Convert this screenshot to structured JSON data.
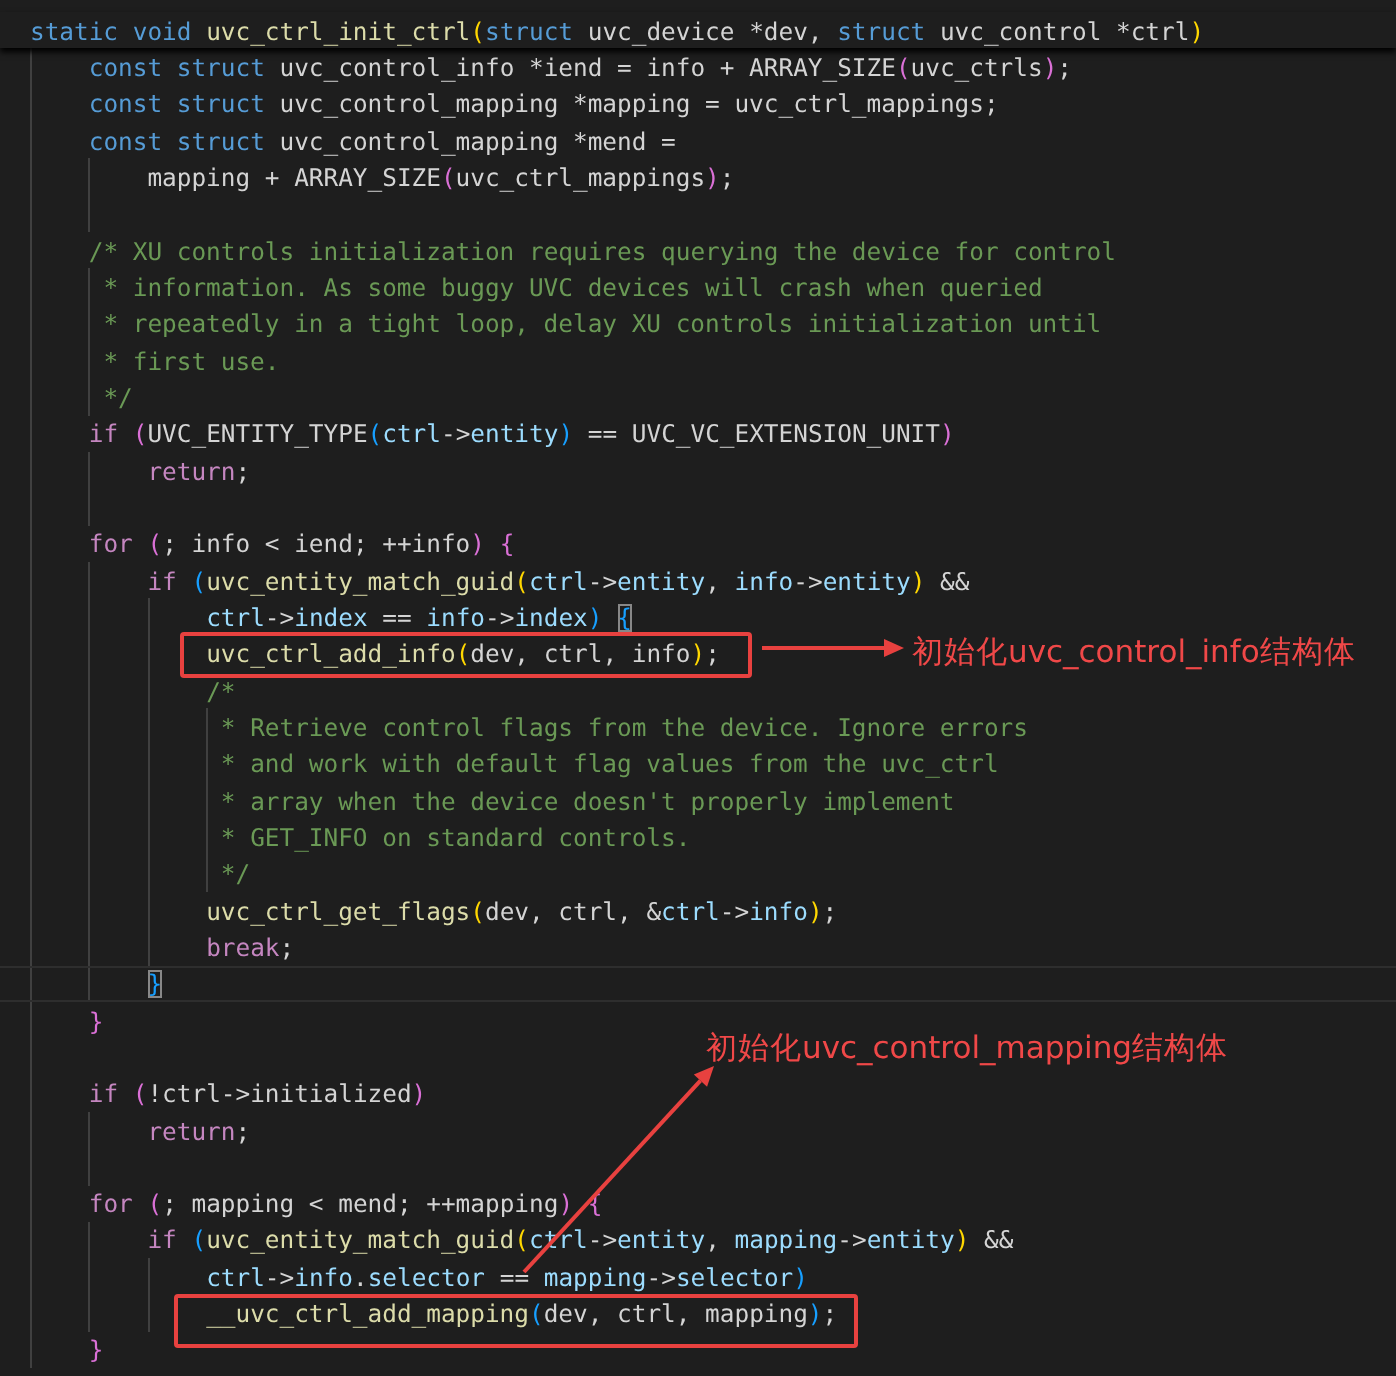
{
  "editor": {
    "lines": [
      {
        "kind": "header",
        "current": false,
        "tokens": [
          {
            "kind": "keyword",
            "text": "static void "
          },
          {
            "kind": "function",
            "text": "uvc_ctrl_init_ctrl"
          },
          {
            "kind": "bracket1",
            "text": "("
          },
          {
            "kind": "keyword",
            "text": "struct"
          },
          {
            "kind": "text",
            "text": " uvc_device *dev, "
          },
          {
            "kind": "keyword",
            "text": "struct"
          },
          {
            "kind": "text",
            "text": " uvc_control *ctrl"
          },
          {
            "kind": "bracket1",
            "text": ")"
          }
        ]
      },
      {
        "kind": "code",
        "current": false,
        "tokens": [
          {
            "kind": "keyword",
            "text": "    const struct"
          },
          {
            "kind": "text",
            "text": " uvc_control_info *iend = info + ARRAY_SIZE"
          },
          {
            "kind": "bracket2",
            "text": "("
          },
          {
            "kind": "text",
            "text": "uvc_ctrls"
          },
          {
            "kind": "bracket2",
            "text": ")"
          },
          {
            "kind": "text",
            "text": ";"
          }
        ]
      },
      {
        "kind": "code",
        "current": false,
        "tokens": [
          {
            "kind": "keyword",
            "text": "    const struct"
          },
          {
            "kind": "text",
            "text": " uvc_control_mapping *mapping = uvc_ctrl_mappings;"
          }
        ]
      },
      {
        "kind": "code",
        "current": false,
        "tokens": [
          {
            "kind": "keyword",
            "text": "    const struct"
          },
          {
            "kind": "text",
            "text": " uvc_control_mapping *mend ="
          }
        ]
      },
      {
        "kind": "code",
        "current": false,
        "tokens": [
          {
            "kind": "text",
            "text": "        mapping + ARRAY_SIZE"
          },
          {
            "kind": "bracket2",
            "text": "("
          },
          {
            "kind": "text",
            "text": "uvc_ctrl_mappings"
          },
          {
            "kind": "bracket2",
            "text": ")"
          },
          {
            "kind": "text",
            "text": ";"
          }
        ]
      },
      {
        "kind": "blank",
        "current": false
      },
      {
        "kind": "code",
        "current": false,
        "tokens": [
          {
            "kind": "comment",
            "text": "    /* XU controls initialization requires querying the device for control"
          }
        ]
      },
      {
        "kind": "code",
        "current": false,
        "tokens": [
          {
            "kind": "comment",
            "text": "     * information. As some buggy UVC devices will crash when queried"
          }
        ]
      },
      {
        "kind": "code",
        "current": false,
        "tokens": [
          {
            "kind": "comment",
            "text": "     * repeatedly in a tight loop, delay XU controls initialization until"
          }
        ]
      },
      {
        "kind": "code",
        "current": false,
        "tokens": [
          {
            "kind": "comment",
            "text": "     * first use."
          }
        ]
      },
      {
        "kind": "code",
        "current": false,
        "tokens": [
          {
            "kind": "comment",
            "text": "     */"
          }
        ]
      },
      {
        "kind": "code",
        "current": false,
        "tokens": [
          {
            "kind": "control",
            "text": "    if "
          },
          {
            "kind": "bracket2",
            "text": "("
          },
          {
            "kind": "text",
            "text": "UVC_ENTITY_TYPE"
          },
          {
            "kind": "bracket3",
            "text": "("
          },
          {
            "kind": "variable",
            "text": "ctrl"
          },
          {
            "kind": "text",
            "text": "->"
          },
          {
            "kind": "variable",
            "text": "entity"
          },
          {
            "kind": "bracket3",
            "text": ")"
          },
          {
            "kind": "text",
            "text": " == UVC_VC_EXTENSION_UNIT"
          },
          {
            "kind": "bracket2",
            "text": ")"
          }
        ]
      },
      {
        "kind": "code",
        "current": false,
        "tokens": [
          {
            "kind": "control",
            "text": "        return"
          },
          {
            "kind": "text",
            "text": ";"
          }
        ]
      },
      {
        "kind": "blank",
        "current": false
      },
      {
        "kind": "code",
        "current": false,
        "tokens": [
          {
            "kind": "control",
            "text": "    for "
          },
          {
            "kind": "bracket2",
            "text": "("
          },
          {
            "kind": "text",
            "text": "; info < iend; ++info"
          },
          {
            "kind": "bracket2",
            "text": ") {"
          }
        ]
      },
      {
        "kind": "code",
        "current": false,
        "tokens": [
          {
            "kind": "control",
            "text": "        if "
          },
          {
            "kind": "bracket3",
            "text": "("
          },
          {
            "kind": "function",
            "text": "uvc_entity_match_guid"
          },
          {
            "kind": "bracket1",
            "text": "("
          },
          {
            "kind": "variable",
            "text": "ctrl"
          },
          {
            "kind": "text",
            "text": "->"
          },
          {
            "kind": "variable",
            "text": "entity"
          },
          {
            "kind": "text",
            "text": ", "
          },
          {
            "kind": "variable",
            "text": "info"
          },
          {
            "kind": "text",
            "text": "->"
          },
          {
            "kind": "variable",
            "text": "entity"
          },
          {
            "kind": "bracket1",
            "text": ")"
          },
          {
            "kind": "text",
            "text": " &&"
          }
        ]
      },
      {
        "kind": "code",
        "current": false,
        "tokens": [
          {
            "kind": "variable",
            "text": "            ctrl"
          },
          {
            "kind": "text",
            "text": "->"
          },
          {
            "kind": "variable",
            "text": "index"
          },
          {
            "kind": "text",
            "text": " == "
          },
          {
            "kind": "variable",
            "text": "info"
          },
          {
            "kind": "text",
            "text": "->"
          },
          {
            "kind": "variable",
            "text": "index"
          },
          {
            "kind": "bracket3",
            "text": ") "
          },
          {
            "kind": "match",
            "text": "{"
          }
        ]
      },
      {
        "kind": "code",
        "current": false,
        "tokens": [
          {
            "kind": "function",
            "text": "            uvc_ctrl_add_info"
          },
          {
            "kind": "bracket1",
            "text": "("
          },
          {
            "kind": "text",
            "text": "dev, ctrl, info"
          },
          {
            "kind": "bracket1",
            "text": ")"
          },
          {
            "kind": "text",
            "text": ";"
          }
        ]
      },
      {
        "kind": "code",
        "current": false,
        "tokens": [
          {
            "kind": "comment",
            "text": "            /*"
          }
        ]
      },
      {
        "kind": "code",
        "current": false,
        "tokens": [
          {
            "kind": "comment",
            "text": "             * Retrieve control flags from the device. Ignore errors"
          }
        ]
      },
      {
        "kind": "code",
        "current": false,
        "tokens": [
          {
            "kind": "comment",
            "text": "             * and work with default flag values from the uvc_ctrl"
          }
        ]
      },
      {
        "kind": "code",
        "current": false,
        "tokens": [
          {
            "kind": "comment",
            "text": "             * array when the device doesn't properly implement"
          }
        ]
      },
      {
        "kind": "code",
        "current": false,
        "tokens": [
          {
            "kind": "comment",
            "text": "             * GET_INFO on standard controls."
          }
        ]
      },
      {
        "kind": "code",
        "current": false,
        "tokens": [
          {
            "kind": "comment",
            "text": "             */"
          }
        ]
      },
      {
        "kind": "code",
        "current": false,
        "tokens": [
          {
            "kind": "function",
            "text": "            uvc_ctrl_get_flags"
          },
          {
            "kind": "bracket1",
            "text": "("
          },
          {
            "kind": "text",
            "text": "dev, ctrl, &"
          },
          {
            "kind": "variable",
            "text": "ctrl"
          },
          {
            "kind": "text",
            "text": "->"
          },
          {
            "kind": "variable",
            "text": "info"
          },
          {
            "kind": "bracket1",
            "text": ")"
          },
          {
            "kind": "text",
            "text": ";"
          }
        ]
      },
      {
        "kind": "code",
        "current": false,
        "tokens": [
          {
            "kind": "control",
            "text": "            break"
          },
          {
            "kind": "text",
            "text": ";"
          }
        ]
      },
      {
        "kind": "code",
        "current": true,
        "tokens": [
          {
            "kind": "match",
            "text": "        }"
          }
        ]
      },
      {
        "kind": "code",
        "current": false,
        "tokens": [
          {
            "kind": "bracket2",
            "text": "    }"
          }
        ]
      },
      {
        "kind": "blank",
        "current": false
      },
      {
        "kind": "code",
        "current": false,
        "tokens": [
          {
            "kind": "control",
            "text": "    if "
          },
          {
            "kind": "bracket2",
            "text": "("
          },
          {
            "kind": "text",
            "text": "!ctrl->initialized"
          },
          {
            "kind": "bracket2",
            "text": ")"
          }
        ]
      },
      {
        "kind": "code",
        "current": false,
        "tokens": [
          {
            "kind": "control",
            "text": "        return"
          },
          {
            "kind": "text",
            "text": ";"
          }
        ]
      },
      {
        "kind": "blank",
        "current": false
      },
      {
        "kind": "code",
        "current": false,
        "tokens": [
          {
            "kind": "control",
            "text": "    for "
          },
          {
            "kind": "bracket2",
            "text": "("
          },
          {
            "kind": "text",
            "text": "; mapping < mend; ++mapping"
          },
          {
            "kind": "bracket2",
            "text": ") {"
          }
        ]
      },
      {
        "kind": "code",
        "current": false,
        "tokens": [
          {
            "kind": "control",
            "text": "        if "
          },
          {
            "kind": "bracket3",
            "text": "("
          },
          {
            "kind": "function",
            "text": "uvc_entity_match_guid"
          },
          {
            "kind": "bracket1",
            "text": "("
          },
          {
            "kind": "variable",
            "text": "ctrl"
          },
          {
            "kind": "text",
            "text": "->"
          },
          {
            "kind": "variable",
            "text": "entity"
          },
          {
            "kind": "text",
            "text": ", "
          },
          {
            "kind": "variable",
            "text": "mapping"
          },
          {
            "kind": "text",
            "text": "->"
          },
          {
            "kind": "variable",
            "text": "entity"
          },
          {
            "kind": "bracket1",
            "text": ")"
          },
          {
            "kind": "text",
            "text": " &&"
          }
        ]
      },
      {
        "kind": "code",
        "current": false,
        "tokens": [
          {
            "kind": "variable",
            "text": "            ctrl"
          },
          {
            "kind": "text",
            "text": "->"
          },
          {
            "kind": "variable",
            "text": "info"
          },
          {
            "kind": "text",
            "text": "."
          },
          {
            "kind": "variable",
            "text": "selector"
          },
          {
            "kind": "text",
            "text": " == "
          },
          {
            "kind": "variable",
            "text": "mapping"
          },
          {
            "kind": "text",
            "text": "->"
          },
          {
            "kind": "variable",
            "text": "selector"
          },
          {
            "kind": "bracket3",
            "text": ")"
          }
        ]
      },
      {
        "kind": "code",
        "current": false,
        "tokens": [
          {
            "kind": "function",
            "text": "            __uvc_ctrl_add_mapping"
          },
          {
            "kind": "bracket3",
            "text": "("
          },
          {
            "kind": "text",
            "text": "dev, ctrl, mapping"
          },
          {
            "kind": "bracket3",
            "text": ")"
          },
          {
            "kind": "text",
            "text": ";"
          }
        ]
      },
      {
        "kind": "code",
        "current": false,
        "tokens": [
          {
            "kind": "bracket2",
            "text": "    }"
          }
        ]
      }
    ]
  },
  "annotations": [
    {
      "label": "初始化uvc_control_info结构体"
    },
    {
      "label": "初始化uvc_control_mapping结构体"
    }
  ]
}
